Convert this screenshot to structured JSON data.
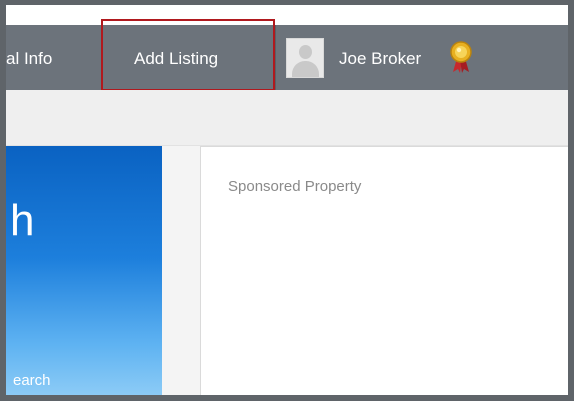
{
  "nav": {
    "personal_info_label": "al Info",
    "add_listing_label": "Add Listing",
    "user_name": "Joe Broker"
  },
  "promo": {
    "heading_fragment": "h",
    "link_fragment": "earch"
  },
  "sponsored": {
    "label": "Sponsored Property"
  },
  "colors": {
    "topbar": "#6c737b",
    "highlight": "#b0191e",
    "promo_blue": "#1d7fdc"
  },
  "icons": {
    "avatar": "user-avatar-placeholder",
    "award": "award-ribbon-icon"
  }
}
